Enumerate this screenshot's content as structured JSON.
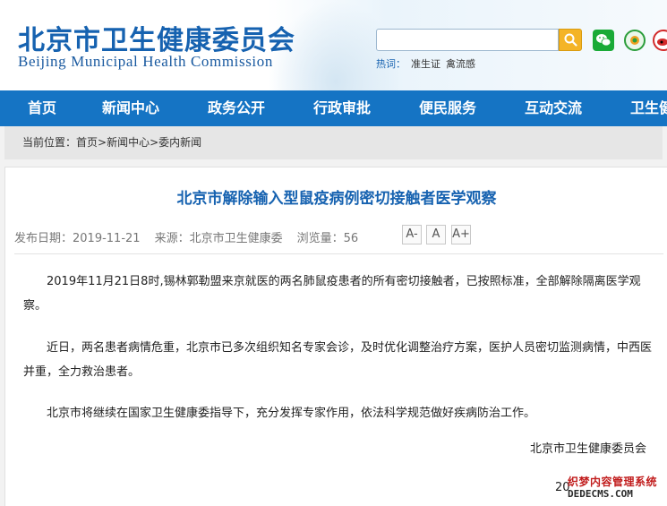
{
  "header": {
    "logo_cn": "北京市卫生健康委员会",
    "logo_en": "Beijing Municipal Health Commission",
    "search_placeholder": "",
    "hot_label": "热词：",
    "hot_words": [
      "准生证",
      "禽流感"
    ],
    "icons": [
      "search-icon",
      "wechat-icon",
      "app-icon",
      "weibo-icon"
    ]
  },
  "nav": {
    "items": [
      "首页",
      "新闻中心",
      "政务公开",
      "行政审批",
      "便民服务",
      "互动交流",
      "卫生健"
    ]
  },
  "breadcrumb": {
    "label": "当前位置：",
    "path": "首页>新闻中心>委内新闻"
  },
  "article": {
    "title": "北京市解除输入型鼠疫病例密切接触者医学观察",
    "publish_date": "发布日期：2019-11-21",
    "source": "来源：北京市卫生健康委",
    "views": "浏览量：56",
    "font_buttons": [
      "A-",
      "A",
      "A+"
    ],
    "paragraphs": [
      "2019年11月21日8时,锡林郭勒盟来京就医的两名肺鼠疫患者的所有密切接触者，已按照标准，全部解除隔离医学观察。",
      "近日，两名患者病情危重，北京市已多次组织知名专家会诊，及时优化调整治疗方案，医护人员密切监测病情，中西医并重，全力救治患者。",
      "北京市将继续在国家卫生健康委指导下，充分发挥专家作用，依法科学规范做好疾病防治工作。"
    ],
    "signature": "北京市卫生健康委员会",
    "date_partial": "20"
  },
  "watermark": {
    "cn": "织梦内容管理系统",
    "en": "DEDECMS.COM"
  },
  "colors": {
    "brand_blue": "#1662b0",
    "nav_bg": "#1574c4",
    "search_button": "#f4b426"
  }
}
